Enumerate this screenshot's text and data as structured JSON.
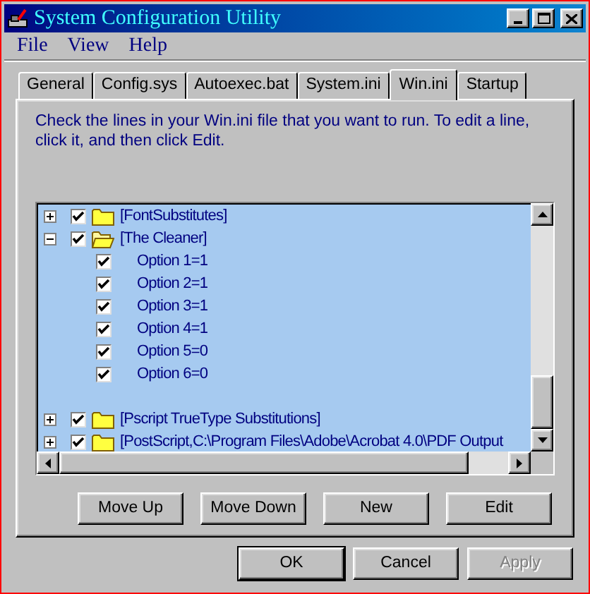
{
  "window": {
    "title": "System Configuration Utility"
  },
  "menu": [
    "File",
    "View",
    "Help"
  ],
  "tabs": [
    {
      "label": "General",
      "selected": false
    },
    {
      "label": "Config.sys",
      "selected": false
    },
    {
      "label": "Autoexec.bat",
      "selected": false
    },
    {
      "label": "System.ini",
      "selected": false
    },
    {
      "label": "Win.ini",
      "selected": true
    },
    {
      "label": "Startup",
      "selected": false
    }
  ],
  "description": "Check the lines in your Win.ini file that you want to run. To edit a line, click it, and then click Edit.",
  "tree": [
    {
      "label": "[FontSubstitutes]",
      "checked": true,
      "expanded": false
    },
    {
      "label": "[The Cleaner]",
      "checked": true,
      "expanded": true,
      "children": [
        {
          "label": "Option 1=1",
          "checked": true
        },
        {
          "label": "Option 2=1",
          "checked": true
        },
        {
          "label": "Option 3=1",
          "checked": true
        },
        {
          "label": "Option 4=1",
          "checked": true
        },
        {
          "label": "Option 5=0",
          "checked": true
        },
        {
          "label": "Option 6=0",
          "checked": true
        }
      ]
    },
    {
      "label": "[Pscript TrueType Substitutions]",
      "checked": true,
      "expanded": false
    },
    {
      "label": "[PostScript,C:\\Program Files\\Adobe\\Acrobat 4.0\\PDF Output",
      "checked": true,
      "expanded": false
    }
  ],
  "list_buttons": [
    {
      "label": "Move Up"
    },
    {
      "label": "Move Down"
    },
    {
      "label": "New"
    },
    {
      "label": "Edit"
    }
  ],
  "dialog_buttons": [
    {
      "label": "OK",
      "default": true,
      "disabled": false
    },
    {
      "label": "Cancel",
      "default": false,
      "disabled": false
    },
    {
      "label": "Apply",
      "default": false,
      "disabled": true
    }
  ]
}
